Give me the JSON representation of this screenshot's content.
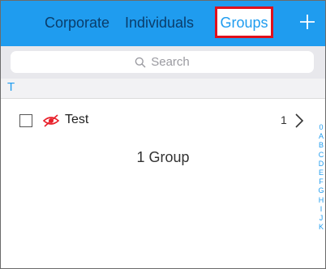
{
  "topbar": {
    "tabs": [
      {
        "label": "Corporate"
      },
      {
        "label": "Individuals"
      },
      {
        "label": "Groups",
        "selected": true
      }
    ],
    "add_icon": "plus-icon",
    "colors": {
      "background": "#1f9cef",
      "highlight_border": "#e0101c"
    }
  },
  "search": {
    "placeholder": "Search",
    "icon": "search-icon"
  },
  "section": {
    "letter": "T"
  },
  "rows": [
    {
      "name": "Test",
      "count": "1",
      "icon": "hidden-eye-icon",
      "checked": false
    }
  ],
  "footer": {
    "count_label": "1 Group"
  },
  "index": [
    "0",
    "A",
    "B",
    "C",
    "D",
    "E",
    "F",
    "G",
    "H",
    "I",
    "J",
    "K"
  ]
}
